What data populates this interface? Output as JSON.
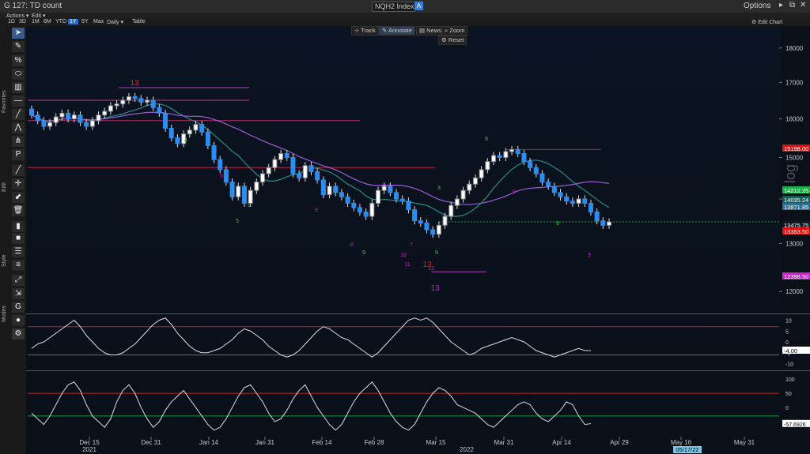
{
  "window": {
    "title": "G 127: TD count",
    "ticker": "NQH2 Index",
    "ticker_btn": "A",
    "options": "Options",
    "btn_min": "▸",
    "btn_restore": "⧉",
    "btn_close": "✕"
  },
  "menu": {
    "actions": "Actions ▾",
    "edit": "Edit ▾"
  },
  "ranges": {
    "items": [
      "1D",
      "3D",
      "1M",
      "6M",
      "YTD",
      "1Y",
      "5Y",
      "Max",
      "Daily ▾",
      "Table"
    ],
    "active": "1Y"
  },
  "edit_chart": "⚙ Edit Chart",
  "chart_buttons": {
    "track": "Track",
    "annotate": "Annotate",
    "news": "News",
    "zoom": "Zoom",
    "reset": "Reset"
  },
  "toolbar_labels": {
    "favorites": "Favorites",
    "edit": "Edit",
    "style": "Style",
    "modes": "Modes"
  },
  "toolbar_icons": [
    "cursor-icon",
    "pencil-icon",
    "percent-icon",
    "ellipse-icon",
    "fib-icon",
    "hline-icon",
    "trendline-icon",
    "zigzag-icon",
    "pitchfork-icon",
    "line-tool-icon",
    "crosshair-icon",
    "fill-icon",
    "trash-icon",
    "candle-style-icon",
    "square-icon",
    "line-width-icon",
    "line-style-icon",
    "mode-snap-icon",
    "mode-magnet-icon",
    "mode-lock-icon",
    "palette-icon",
    "settings-icon"
  ],
  "watermark": "log",
  "price_axis": {
    "ticks": [
      "18000",
      "17000",
      "16000",
      "15000",
      "14000",
      "13000",
      "12000"
    ]
  },
  "price_tags": [
    {
      "value": "15198.00",
      "color": "#e01010"
    },
    {
      "value": "14212.25",
      "color": "#1dae4a"
    },
    {
      "value": "14035.24",
      "color": "#1a5c5a"
    },
    {
      "value": "13871.85",
      "color": "#2a6f98"
    },
    {
      "value": "13475.75",
      "color": "#101820"
    },
    {
      "value": "13353.50",
      "color": "#e01010"
    },
    {
      "value": "12398.50",
      "color": "#d21ed2"
    }
  ],
  "osc1_axis": {
    "ticks": [
      "10",
      "5",
      "0",
      "-5",
      "-10"
    ],
    "tag": "-4.00"
  },
  "osc2_axis": {
    "ticks": [
      "100",
      "50",
      "0",
      "-50"
    ],
    "tag": "-57.6926"
  },
  "x_axis": {
    "ticks": [
      "Dec 15",
      "Dec 31",
      "Jan 14",
      "Jan 31",
      "Feb 14",
      "Feb 28",
      "Mar 15",
      "Mar 31",
      "Apr 14",
      "Apr 29",
      "May 16",
      "May 31"
    ],
    "years": [
      "2021",
      "2022"
    ],
    "date_tag": "05/17/22"
  },
  "td_labels": [
    "13",
    "13",
    "13",
    "9",
    "9",
    "9",
    "9",
    "9",
    "9",
    "9",
    "9",
    "9",
    "8",
    "7",
    "5",
    "4",
    "3",
    "10",
    "11",
    "12"
  ],
  "chart_data": {
    "type": "candlestick",
    "scale": "log",
    "ylim": [
      11600,
      18500
    ],
    "closes": [
      16100,
      15950,
      15800,
      15900,
      16050,
      16150,
      16000,
      16100,
      15900,
      15800,
      15950,
      16100,
      16200,
      16350,
      16400,
      16500,
      16600,
      16550,
      16450,
      16500,
      16300,
      16150,
      15750,
      15500,
      15350,
      15600,
      15700,
      15850,
      15650,
      15300,
      14950,
      14700,
      14400,
      14050,
      14300,
      13900,
      14200,
      14400,
      14600,
      14750,
      14950,
      15100,
      15000,
      14600,
      14500,
      14800,
      14650,
      14450,
      14100,
      14300,
      14150,
      14050,
      13900,
      13800,
      13700,
      13600,
      13900,
      14200,
      14300,
      14150,
      14000,
      13950,
      13750,
      13500,
      13450,
      13300,
      13200,
      13400,
      13600,
      13850,
      14000,
      14200,
      14350,
      14500,
      14700,
      14900,
      15050,
      15000,
      15150,
      15200,
      15100,
      14900,
      14750,
      14600,
      14400,
      14300,
      14150,
      14050,
      13950,
      13900,
      14000,
      13900,
      13700,
      13500,
      13400,
      13475
    ],
    "oscillator1": [
      -3,
      -1,
      0,
      2,
      4,
      6,
      8,
      10,
      7,
      3,
      0,
      -3,
      -5,
      -6,
      -6,
      -5,
      -3,
      -1,
      2,
      5,
      8,
      10,
      11,
      8,
      4,
      1,
      -2,
      -4,
      -5,
      -5,
      -4,
      -3,
      -1,
      1,
      4,
      6,
      5,
      3,
      1,
      -2,
      -4,
      -6,
      -7,
      -6,
      -4,
      -1,
      2,
      5,
      7,
      6,
      4,
      2,
      1,
      -1,
      -3,
      -5,
      -7,
      -5,
      -2,
      1,
      4,
      7,
      10,
      11,
      10,
      11,
      9,
      6,
      3,
      0,
      -2,
      -4,
      -6,
      -5,
      -3,
      -2,
      -1,
      0,
      1,
      2,
      1,
      0,
      -2,
      -4,
      -5,
      -6,
      -7,
      -6,
      -5,
      -4,
      -3,
      -4,
      -4
    ],
    "oscillator2": [
      -20,
      -40,
      -60,
      -30,
      10,
      50,
      80,
      90,
      60,
      10,
      -30,
      -50,
      -70,
      -40,
      20,
      60,
      80,
      50,
      0,
      -40,
      -70,
      -50,
      -10,
      20,
      40,
      60,
      30,
      0,
      -30,
      -60,
      -80,
      -70,
      -40,
      0,
      40,
      70,
      80,
      50,
      20,
      -20,
      -50,
      -40,
      -10,
      30,
      60,
      80,
      40,
      0,
      -30,
      -60,
      -80,
      -60,
      -20,
      20,
      50,
      70,
      90,
      60,
      20,
      -20,
      -50,
      -70,
      -80,
      -60,
      -20,
      20,
      50,
      70,
      60,
      40,
      10,
      0,
      -10,
      -20,
      -40,
      -60,
      -70,
      -50,
      -30,
      -10,
      10,
      20,
      10,
      -20,
      -40,
      -50,
      -30,
      -10,
      20,
      10,
      -30,
      -60,
      -57
    ]
  }
}
